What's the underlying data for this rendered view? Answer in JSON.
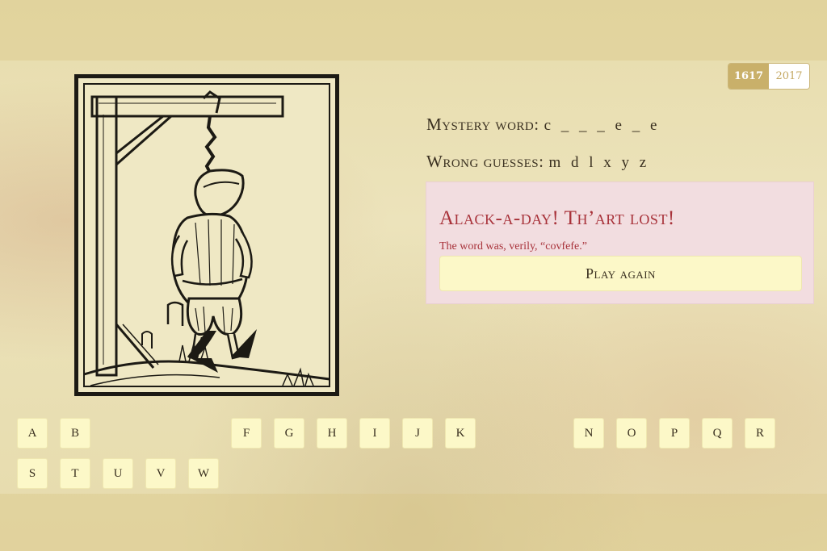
{
  "era_toggle": {
    "active": "1617",
    "inactive": "2017"
  },
  "mystery": {
    "label": "Mystery word:",
    "value": "c _ _ _ e _ e"
  },
  "wrong": {
    "label": "Wrong guesses:",
    "value": "m d l x y z"
  },
  "alert": {
    "title": "Alack-a-day! Th’art lost!",
    "text": "The word was, verily, “covfefe.”",
    "button": "Play again"
  },
  "keyboard": {
    "row1": [
      "A",
      "B",
      "F",
      "G",
      "H",
      "I",
      "J",
      "K",
      "N",
      "O",
      "P",
      "Q",
      "R"
    ],
    "row2": [
      "S",
      "T",
      "U",
      "V",
      "W"
    ]
  },
  "colors": {
    "accent": "#c9b06a",
    "lose_text": "#a8323a",
    "alert_bg": "#f2dde0",
    "key_bg": "#fcf8c8"
  },
  "icons": {
    "illustration": "hanged-man-woodcut"
  }
}
